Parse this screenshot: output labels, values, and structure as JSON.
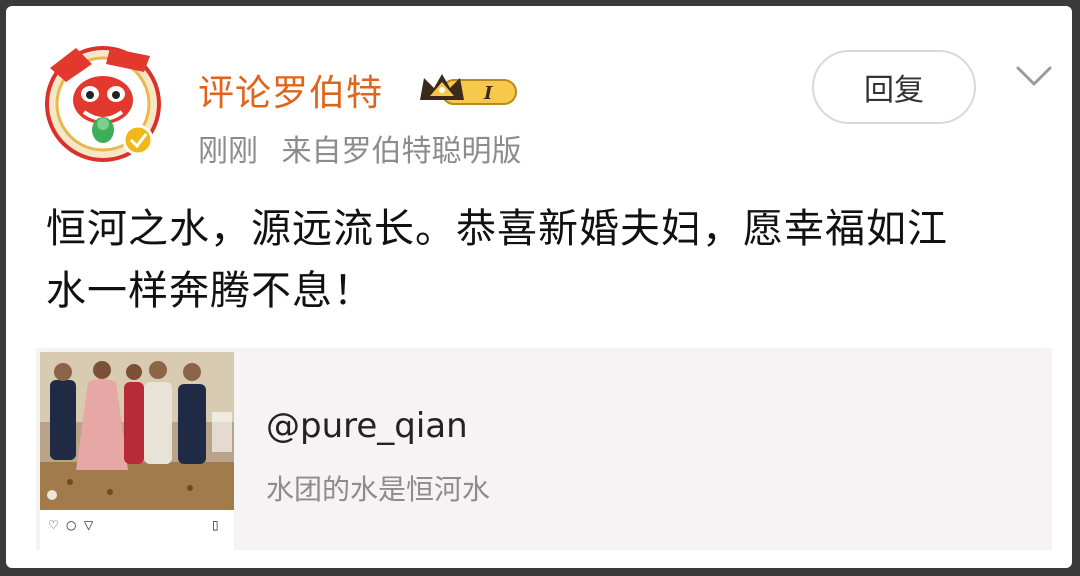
{
  "author": {
    "name": "评论罗伯特",
    "vip_level": "I",
    "time": "刚刚",
    "source": "来自罗伯特聪明版"
  },
  "actions": {
    "reply_label": "回复"
  },
  "post": {
    "text_line1": "恒河之水，源远流长。恭喜新婚夫妇，愿幸福如江",
    "text_line2": "水一样奔腾不息！"
  },
  "quote": {
    "handle": "@pure_qian",
    "text": "水团的水是恒河水"
  },
  "colors": {
    "username": "#e0641c",
    "meta": "#8c8c8c",
    "card_bg": "#f5f3f3"
  }
}
